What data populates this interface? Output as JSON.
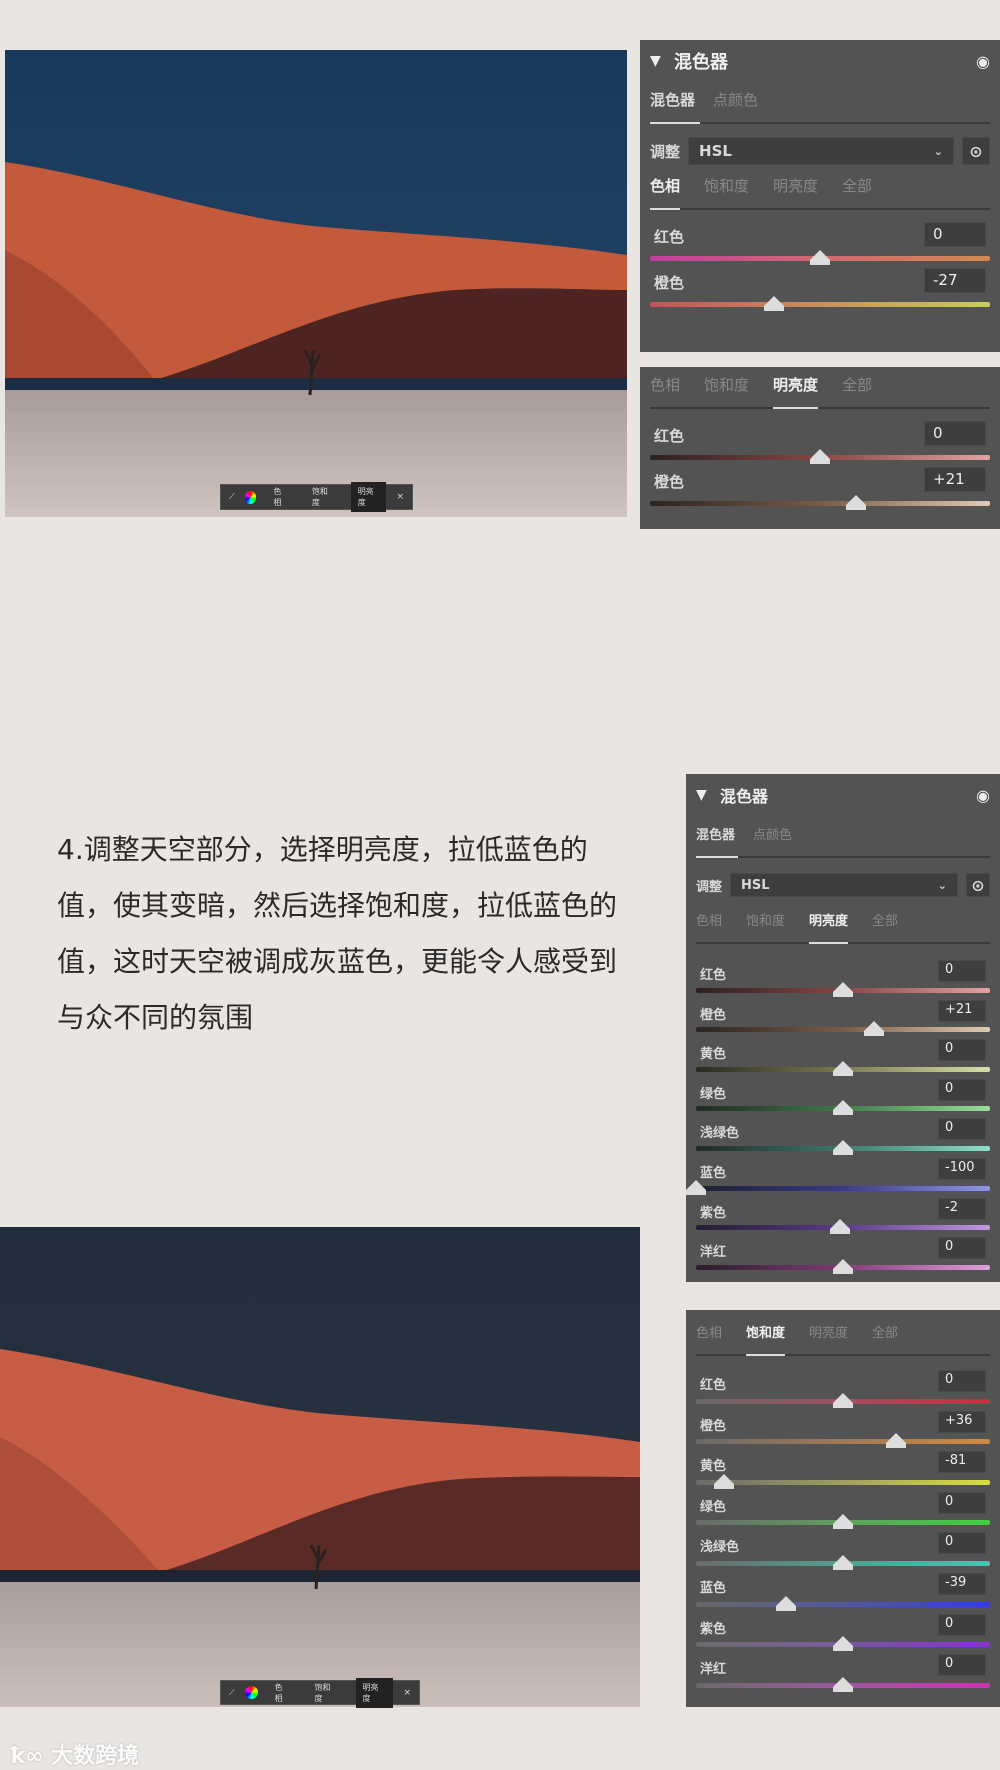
{
  "toolbar": {
    "hue": "色相",
    "sat": "饱和度",
    "lum": "明亮度",
    "close": "×"
  },
  "mixer": {
    "title": "混色器",
    "tab_mixer": "混色器",
    "tab_point": "点颜色",
    "adjust_label": "调整",
    "adjust_value": "HSL",
    "tabs": [
      "色相",
      "饱和度",
      "明亮度",
      "全部"
    ]
  },
  "panel1": {
    "active_tab": 0,
    "rows": [
      {
        "label": "红色",
        "value": "0",
        "n": 0,
        "grad": [
          "#c43ea0",
          "#d06a70",
          "#d38850"
        ]
      },
      {
        "label": "橙色",
        "value": "-27",
        "n": -27,
        "grad": [
          "#c9505a",
          "#c9905a",
          "#c8d050"
        ]
      }
    ]
  },
  "panel2": {
    "active_tab": 2,
    "rows": [
      {
        "label": "红色",
        "value": "0",
        "n": 0,
        "grad": [
          "#2a2020",
          "#8a4545",
          "#e3a3a3"
        ]
      },
      {
        "label": "橙色",
        "value": "+21",
        "n": 21,
        "grad": [
          "#2a2420",
          "#7a5a48",
          "#e0cbb4"
        ]
      }
    ]
  },
  "panel3": {
    "active_tab": 2,
    "rows": [
      {
        "label": "红色",
        "value": "0",
        "n": 0,
        "grad": [
          "#2a2020",
          "#8a4545",
          "#e3a3a3"
        ]
      },
      {
        "label": "橙色",
        "value": "+21",
        "n": 21,
        "grad": [
          "#2a2420",
          "#7a5a48",
          "#e0cbb4"
        ]
      },
      {
        "label": "黄色",
        "value": "0",
        "n": 0,
        "grad": [
          "#2a2a22",
          "#7a7a50",
          "#d8e0a8"
        ]
      },
      {
        "label": "绿色",
        "value": "0",
        "n": 0,
        "grad": [
          "#202a22",
          "#3e7a48",
          "#98e098"
        ]
      },
      {
        "label": "浅绿色",
        "value": "0",
        "n": 0,
        "grad": [
          "#202a28",
          "#3a7a6a",
          "#8ee0c8"
        ]
      },
      {
        "label": "蓝色",
        "value": "-100",
        "n": -100,
        "grad": [
          "#1e2030",
          "#3a3a88",
          "#8e98e8"
        ]
      },
      {
        "label": "紫色",
        "value": "-2",
        "n": -2,
        "grad": [
          "#241e30",
          "#5a3a88",
          "#c09ae0"
        ]
      },
      {
        "label": "洋红",
        "value": "0",
        "n": 0,
        "grad": [
          "#2a1e2a",
          "#803a78",
          "#e0a0d8"
        ]
      }
    ]
  },
  "panel4": {
    "active_tab": 1,
    "rows": [
      {
        "label": "红色",
        "value": "0",
        "n": 0,
        "grad": [
          "#6a6a6a",
          "#a05060",
          "#d02a40"
        ]
      },
      {
        "label": "橙色",
        "value": "+36",
        "n": 36,
        "grad": [
          "#6a6a6a",
          "#a07a58",
          "#d08a40"
        ]
      },
      {
        "label": "黄色",
        "value": "-81",
        "n": -81,
        "grad": [
          "#6a6a6a",
          "#a0a060",
          "#d8e040"
        ]
      },
      {
        "label": "绿色",
        "value": "0",
        "n": 0,
        "grad": [
          "#6a6a6a",
          "#60a060",
          "#40d040"
        ]
      },
      {
        "label": "浅绿色",
        "value": "0",
        "n": 0,
        "grad": [
          "#6a6a6a",
          "#50a090",
          "#30d0b0"
        ]
      },
      {
        "label": "蓝色",
        "value": "-39",
        "n": -39,
        "grad": [
          "#6a6a6a",
          "#5058a0",
          "#3040d8"
        ]
      },
      {
        "label": "紫色",
        "value": "0",
        "n": 0,
        "grad": [
          "#6a6a6a",
          "#7a58a0",
          "#8a30d8"
        ]
      },
      {
        "label": "洋红",
        "value": "0",
        "n": 0,
        "grad": [
          "#6a6a6a",
          "#a058a0",
          "#d030b0"
        ]
      }
    ]
  },
  "body_text": "4.调整天空部分，选择明亮度，拉低蓝色的值，使其变暗，然后选择饱和度，拉低蓝色的值，这时天空被调成灰蓝色，更能令人感受到与众不同的氛围",
  "logo": "大数跨境"
}
